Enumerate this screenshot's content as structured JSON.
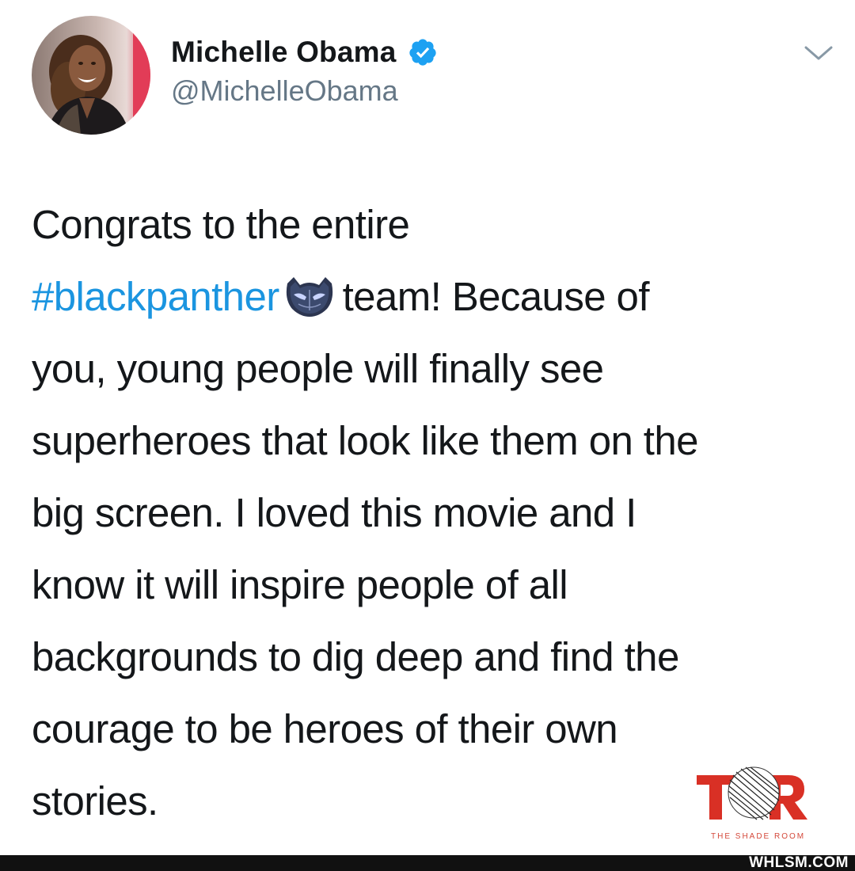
{
  "author": {
    "display_name": "Michelle Obama",
    "handle": "@MichelleObama",
    "verified": true
  },
  "tweet": {
    "lines": [
      {
        "text": "Congrats to the entire"
      },
      {
        "hashtag": "#blackpanther",
        "emoji": "black-panther-mask-emoji",
        "text": "team! Because of"
      },
      {
        "text": "you, young people will finally see"
      },
      {
        "text": "superheroes that look like them on the"
      },
      {
        "text": "big screen. I loved this movie and I"
      },
      {
        "text": "know it will inspire people of all"
      },
      {
        "text": "backgrounds to dig deep and find the"
      },
      {
        "text": "courage to be heroes of their own"
      },
      {
        "text": "stories."
      }
    ]
  },
  "logo": {
    "caption": "THE SHADE ROOM"
  },
  "watermark": {
    "text": "WHLSM.COM"
  },
  "colors": {
    "hashtag": "#1b95e0",
    "verified_badge": "#1da1f2",
    "handle": "#657786",
    "text": "#14171a",
    "logo_red": "#d93025"
  }
}
